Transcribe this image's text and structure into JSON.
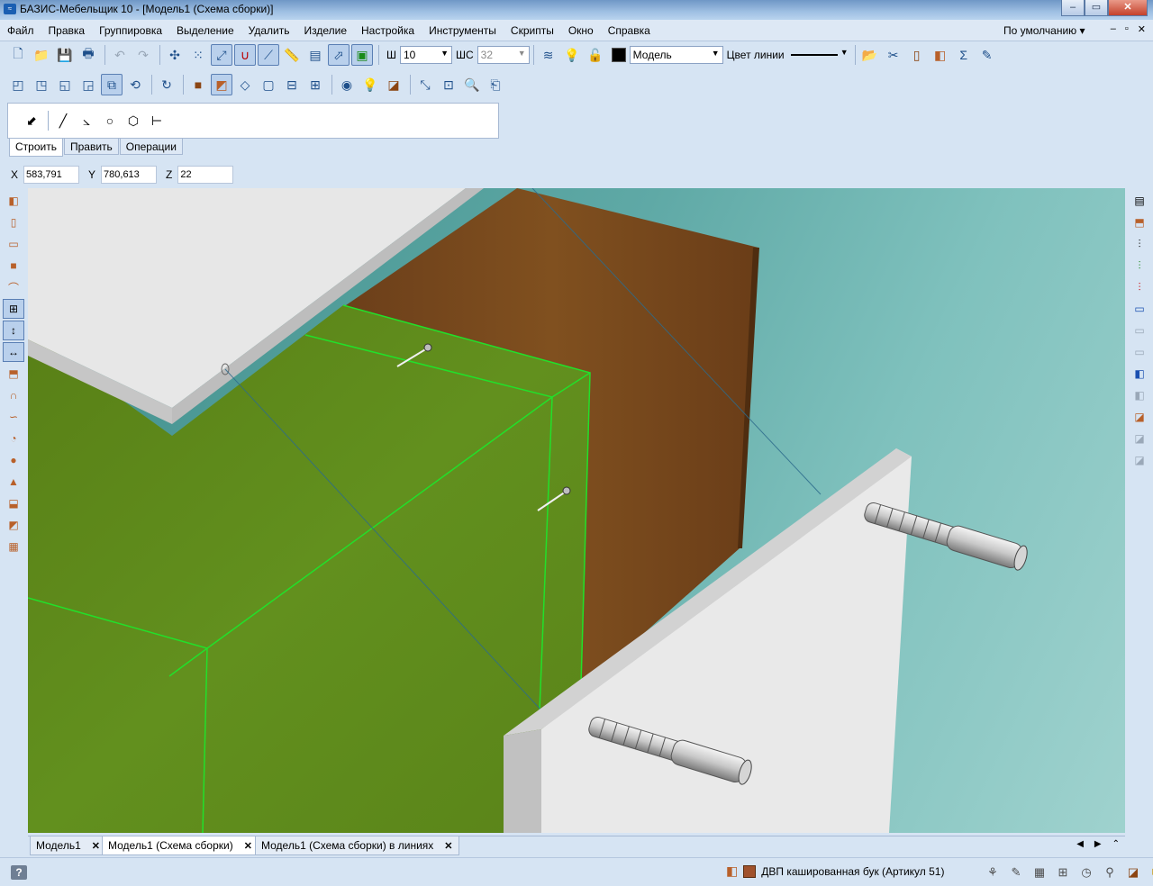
{
  "window": {
    "title": "БАЗИС-Мебельщик 10 - [Модель1 (Схема сборки)]",
    "minimize": "–",
    "maximize": "▭",
    "close": "✕"
  },
  "menu": {
    "items": [
      "Файл",
      "Правка",
      "Группировка",
      "Выделение",
      "Удалить",
      "Изделие",
      "Настройка",
      "Инструменты",
      "Скрипты",
      "Окно",
      "Справка"
    ],
    "preset": "По умолчанию",
    "mdi": [
      "–",
      "▫",
      "✕"
    ]
  },
  "toolbar": {
    "width_label": "Ш",
    "width_value": "10",
    "ws_label": "ШС",
    "ws_value": "32",
    "layer_value": "Модель",
    "line_color_label": "Цвет линии"
  },
  "build_panel": {
    "tabs": [
      "Строить",
      "Править",
      "Операции"
    ]
  },
  "coords": {
    "x_label": "X",
    "x_value": "583,791",
    "y_label": "Y",
    "y_value": "780,613",
    "z_label": "Z",
    "z_value": "22"
  },
  "doc_tabs": [
    "Модель1",
    "Модель1 (Схема сборки)",
    "Модель1 (Схема сборки) в линиях"
  ],
  "status": {
    "help": "?",
    "material": "ДВП кашированная бук (Артикул 51)"
  },
  "colors": {
    "viewport_bg": "#5fa9a6",
    "wood": "#7a4a22",
    "green_panel": "#5f8a1c",
    "wire": "#22e02a",
    "white_panel": "#e8e8e8"
  }
}
